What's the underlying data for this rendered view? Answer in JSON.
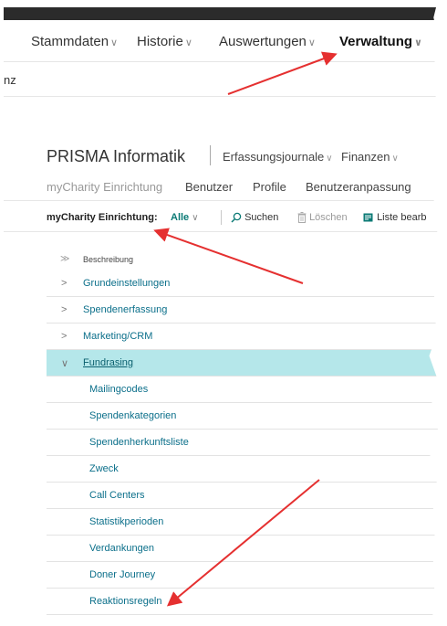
{
  "panel1": {
    "menu": [
      "Stammdaten",
      "Historie",
      "Auswertungen",
      "Verwaltung"
    ],
    "sub_text": "nz"
  },
  "panel2": {
    "company": "PRISMA Informatik",
    "header_menu": [
      "Erfassungsjournale",
      "Finanzen"
    ],
    "tabs": [
      "myCharity Einrichtung",
      "Benutzer",
      "Profile",
      "Benutzeranpassung"
    ],
    "toolbar": {
      "filter_label": "myCharity Einrichtung:",
      "filter_value": "Alle",
      "search": "Suchen",
      "delete": "Löschen",
      "edit_list": "Liste bearb"
    },
    "list": {
      "column_header": "Beschreibung",
      "rows": [
        {
          "label": "Grundeinstellungen",
          "expandable": true
        },
        {
          "label": "Spendenerfassung",
          "expandable": true
        },
        {
          "label": "Marketing/CRM",
          "expandable": true
        },
        {
          "label": "Fundrasing",
          "expandable": true,
          "expanded": true,
          "selected": true
        },
        {
          "label": "Mailingcodes"
        },
        {
          "label": "Spendenkategorien"
        },
        {
          "label": "Spendenherkunftsliste"
        },
        {
          "label": "Zweck"
        },
        {
          "label": "Call Centers"
        },
        {
          "label": "Statistikperioden"
        },
        {
          "label": "Verdankungen"
        },
        {
          "label": "Doner Journey"
        },
        {
          "label": "Reaktionsregeln"
        }
      ]
    }
  },
  "colors": {
    "accent": "#0b7a75",
    "selected_row": "#b5e7ea",
    "link": "#0b6f8a",
    "annotation_arrow": "#e53030"
  }
}
